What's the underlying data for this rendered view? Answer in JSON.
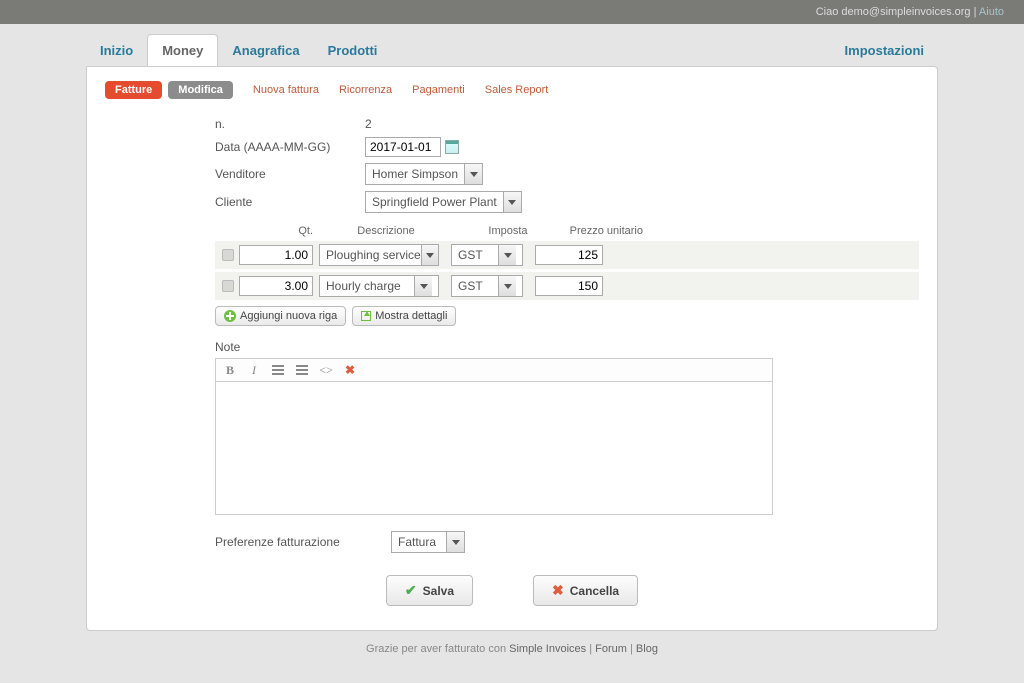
{
  "topbar": {
    "greeting": "Ciao demo@simpleinvoices.org",
    "sep": " | ",
    "help": "Aiuto"
  },
  "nav": {
    "tabs": [
      "Inizio",
      "Money",
      "Anagrafica",
      "Prodotti"
    ],
    "active_index": 1,
    "right": "Impostazioni"
  },
  "subnav": {
    "pills": [
      "Fatture",
      "Modifica"
    ],
    "links": [
      "Nuova fattura",
      "Ricorrenza",
      "Pagamenti",
      "Sales Report"
    ]
  },
  "form": {
    "number_label": "n.",
    "number_value": "2",
    "date_label": "Data (AAAA-MM-GG)",
    "date_value": "2017-01-01",
    "vendor_label": "Venditore",
    "vendor_value": "Homer Simpson",
    "client_label": "Cliente",
    "client_value": "Springfield Power Plant"
  },
  "line_headers": {
    "qty": "Qt.",
    "desc": "Descrizione",
    "tax": "Imposta",
    "price": "Prezzo unitario"
  },
  "lines": [
    {
      "qty": "1.00",
      "desc": "Ploughing service",
      "tax": "GST",
      "price": "125"
    },
    {
      "qty": "3.00",
      "desc": "Hourly charge",
      "tax": "GST",
      "price": "150"
    }
  ],
  "line_buttons": {
    "add": "Aggiungi nuova riga",
    "details": "Mostra dettagli"
  },
  "note_label": "Note",
  "pref": {
    "label": "Preferenze fatturazione",
    "value": "Fattura"
  },
  "actions": {
    "save": "Salva",
    "cancel": "Cancella"
  },
  "footer": {
    "thanks": "Grazie per aver fatturato con ",
    "app": "Simple Invoices",
    "sep": " | ",
    "forum": "Forum",
    "blog": "Blog"
  }
}
